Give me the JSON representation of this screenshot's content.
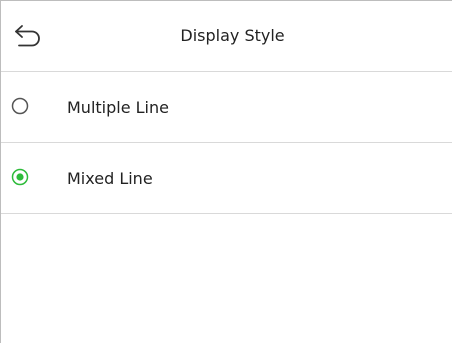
{
  "header": {
    "title": "Display Style",
    "back_icon": "undo-arrow-icon"
  },
  "options": [
    {
      "label": "Multiple Line",
      "selected": false
    },
    {
      "label": "Mixed Line",
      "selected": true
    }
  ],
  "colors": {
    "accent": "#2dbb3a",
    "divider": "#d9d9d9",
    "text": "#222222",
    "radio_outline": "#555555"
  }
}
